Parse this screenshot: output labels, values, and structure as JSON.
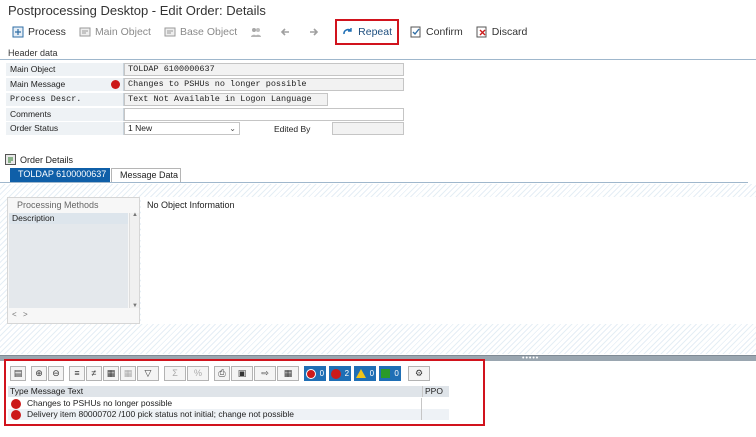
{
  "title": "Postprocessing Desktop - Edit Order: Details",
  "toolbar": {
    "process": "Process",
    "main_object": "Main Object",
    "base_object": "Base Object",
    "repeat": "Repeat",
    "confirm": "Confirm",
    "discard": "Discard"
  },
  "header": {
    "section_title": "Header data",
    "fields": [
      {
        "label": "Main Object",
        "value": "TOLDAP 6100000637"
      },
      {
        "label": "Main Message",
        "value": "Changes to PSHUs no longer possible"
      },
      {
        "label": "Process Descr.",
        "value": "Text Not Available in Logon Language"
      },
      {
        "label": "Comments",
        "value": ""
      },
      {
        "label": "Order Status",
        "value": "1 New"
      }
    ],
    "edited_by_label": "Edited By",
    "edited_by_value": ""
  },
  "order_details": {
    "title": "Order Details",
    "tabs": [
      {
        "label": "TOLDAP 6100000637",
        "active": true
      },
      {
        "label": "Message Data",
        "active": false
      }
    ],
    "processing_methods_title": "Processing Methods",
    "description_header": "Description",
    "info_text": "No Object Information",
    "scroll_left": "<",
    "scroll_right": ">"
  },
  "messages": {
    "counts": {
      "error_stop": "0",
      "error": "2",
      "warning": "0",
      "success": "0"
    },
    "columns": {
      "type_text": "Type Message Text",
      "ppo": "PPO"
    },
    "rows": [
      {
        "type": "error",
        "text": "Changes to PSHUs no longer possible"
      },
      {
        "type": "error",
        "text": "Delivery item 80000702 /100 pick status not initial; change not possible"
      }
    ]
  },
  "colors": {
    "accent": "#0f5fa8",
    "highlight_box": "#d1131d",
    "error_dot": "#cc1a1a"
  }
}
